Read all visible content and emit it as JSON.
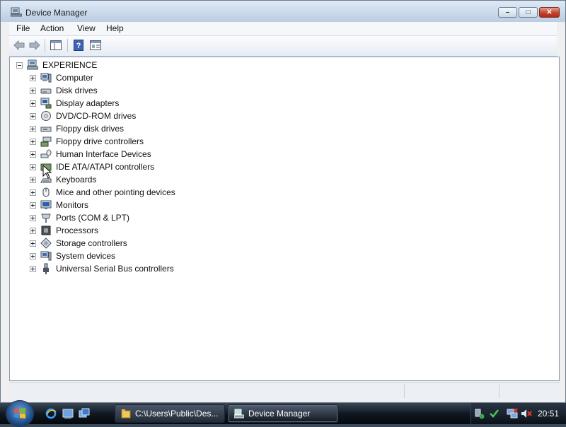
{
  "window": {
    "title": "Device Manager"
  },
  "menubar": [
    "File",
    "Action",
    "View",
    "Help"
  ],
  "tree": {
    "root": "EXPERIENCE",
    "items": [
      {
        "label": "Computer",
        "icon": "computer-icon"
      },
      {
        "label": "Disk drives",
        "icon": "disk-drive-icon"
      },
      {
        "label": "Display adapters",
        "icon": "display-adapter-icon"
      },
      {
        "label": "DVD/CD-ROM drives",
        "icon": "dvd-drive-icon"
      },
      {
        "label": "Floppy disk drives",
        "icon": "floppy-drive-icon"
      },
      {
        "label": "Floppy drive controllers",
        "icon": "floppy-controller-icon"
      },
      {
        "label": "Human Interface Devices",
        "icon": "hid-icon"
      },
      {
        "label": "IDE ATA/ATAPI controllers",
        "icon": "ide-controller-icon"
      },
      {
        "label": "Keyboards",
        "icon": "keyboard-icon"
      },
      {
        "label": "Mice and other pointing devices",
        "icon": "mouse-icon"
      },
      {
        "label": "Monitors",
        "icon": "monitor-icon"
      },
      {
        "label": "Ports (COM & LPT)",
        "icon": "port-icon"
      },
      {
        "label": "Processors",
        "icon": "processor-icon"
      },
      {
        "label": "Storage controllers",
        "icon": "storage-controller-icon"
      },
      {
        "label": "System devices",
        "icon": "system-devices-icon"
      },
      {
        "label": "Universal Serial Bus controllers",
        "icon": "usb-icon"
      }
    ]
  },
  "taskbar": {
    "buttons": [
      {
        "label": "C:\\Users\\Public\\Des...",
        "active": false
      },
      {
        "label": "Device Manager",
        "active": true
      }
    ],
    "clock": "20:51"
  },
  "colors": {
    "window_bg": "#f0f0f0",
    "titlebar": "#c9d8ea",
    "taskbar": "#101823",
    "close_button": "#c44330"
  }
}
